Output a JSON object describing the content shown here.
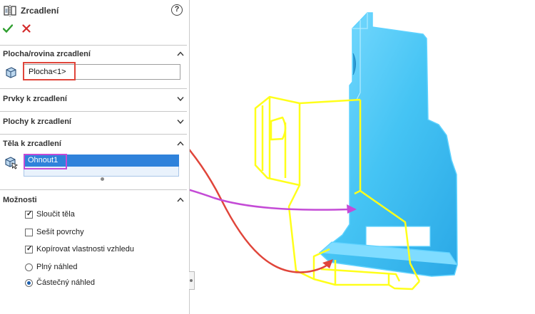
{
  "feature": {
    "title": "Zrcadlení",
    "help_symbol": "?",
    "ok_symbol": "✔",
    "cancel_symbol": "✖"
  },
  "sections": {
    "mirror_plane": {
      "label": "Plocha/rovina zrcadlení",
      "value": "Plocha<1>"
    },
    "features": {
      "label": "Prvky k zrcadlení"
    },
    "faces": {
      "label": "Plochy k zrcadlení"
    },
    "bodies": {
      "label": "Těla k zrcadlení",
      "items": [
        "Ohnout1"
      ]
    },
    "options": {
      "label": "Možnosti",
      "checkboxes": [
        {
          "label": "Sloučit těla",
          "checked": true
        },
        {
          "label": "Sešít povrchy",
          "checked": false
        },
        {
          "label": "Kopírovat vlastnosti vzhledu",
          "checked": true
        }
      ],
      "radios": [
        {
          "label": "Plný náhled",
          "selected": false
        },
        {
          "label": "Částečný náhled",
          "selected": true
        }
      ]
    }
  },
  "colors": {
    "annotation_red": "#e0453a",
    "annotation_magenta": "#c44bd6",
    "body_cyan": "#4cc7f5",
    "preview_yellow": "#ffff1a",
    "selection_blue": "#2f82db"
  }
}
